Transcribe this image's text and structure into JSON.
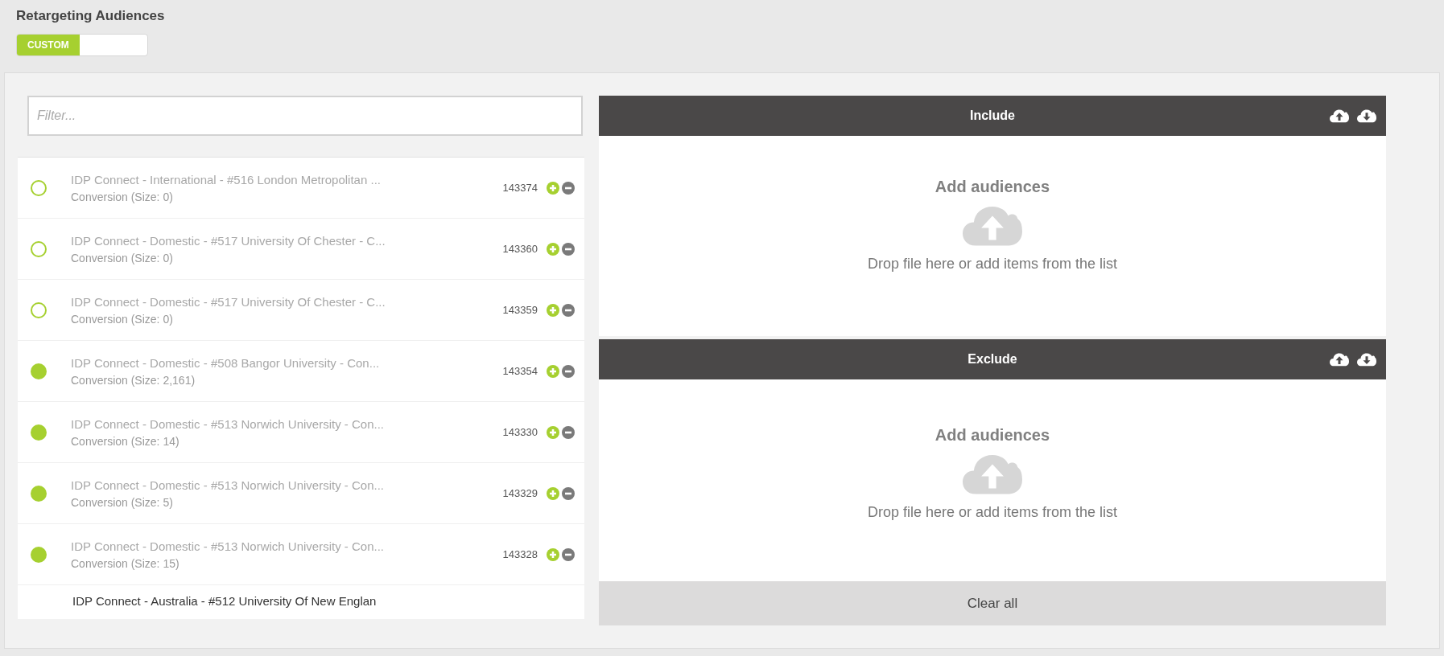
{
  "page_title": "Retargeting Audiences",
  "toggle": {
    "label": "CUSTOM",
    "on": true
  },
  "filter": {
    "placeholder": "Filter..."
  },
  "audiences": [
    {
      "name": "IDP Connect - International - #516 London Metropolitan ...",
      "detail": "Conversion (Size: 0)",
      "id": "143374",
      "active": false
    },
    {
      "name": "IDP Connect - Domestic - #517 University Of Chester - C...",
      "detail": "Conversion (Size: 0)",
      "id": "143360",
      "active": false
    },
    {
      "name": "IDP Connect - Domestic - #517 University Of Chester - C...",
      "detail": "Conversion (Size: 0)",
      "id": "143359",
      "active": false
    },
    {
      "name": "IDP Connect - Domestic - #508 Bangor University - Con...",
      "detail": "Conversion (Size: 2,161)",
      "id": "143354",
      "active": true
    },
    {
      "name": "IDP Connect - Domestic - #513 Norwich University - Con...",
      "detail": "Conversion (Size: 14)",
      "id": "143330",
      "active": true
    },
    {
      "name": "IDP Connect - Domestic - #513 Norwich University - Con...",
      "detail": "Conversion (Size: 5)",
      "id": "143329",
      "active": true
    },
    {
      "name": "IDP Connect - Domestic - #513 Norwich University - Con...",
      "detail": "Conversion (Size: 15)",
      "id": "143328",
      "active": true
    },
    {
      "name": "IDP Connect - Australia - #512 University Of New Englan"
    }
  ],
  "sections": [
    {
      "title": "Include",
      "heading": "Add audiences",
      "hint": "Drop file here or add items from the list"
    },
    {
      "title": "Exclude",
      "heading": "Add audiences",
      "hint": "Drop file here or add items from the list"
    }
  ],
  "clear_button": "Clear all"
}
